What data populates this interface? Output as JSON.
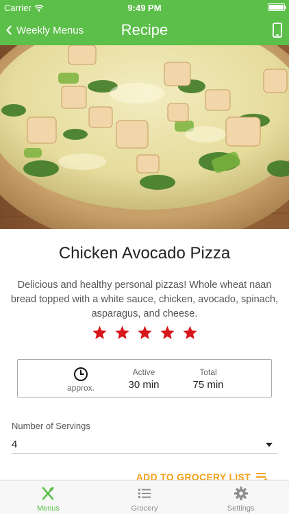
{
  "status_bar": {
    "carrier": "Carrier",
    "time": "9:49 PM",
    "battery_level": 1.0
  },
  "nav": {
    "back_label": "Weekly Menus",
    "title": "Recipe",
    "right_icon": "phone-device-icon"
  },
  "recipe": {
    "title": "Chicken Avocado Pizza",
    "description": "Delicious and healthy personal pizzas! Whole wheat naan bread topped with a white sauce, chicken, avocado, spinach, asparagus, and cheese.",
    "rating": 5,
    "rating_max": 5,
    "rating_color": "#d7161b"
  },
  "time_info": {
    "approx_label": "approx.",
    "active_label": "Active",
    "active_value": "30 min",
    "total_label": "Total",
    "total_value": "75 min"
  },
  "servings": {
    "label": "Number of Servings",
    "value": "4"
  },
  "grocery_button": {
    "label": "ADD TO GROCERY LIST"
  },
  "tabs": [
    {
      "label": "Menus",
      "icon": "utensils-icon",
      "active": true
    },
    {
      "label": "Grocery",
      "icon": "list-icon",
      "active": false
    },
    {
      "label": "Settings",
      "icon": "gear-icon",
      "active": false
    }
  ],
  "colors": {
    "brand_green": "#5cbf4a",
    "accent_orange": "#f0a21b",
    "star_red": "#d7161b"
  }
}
